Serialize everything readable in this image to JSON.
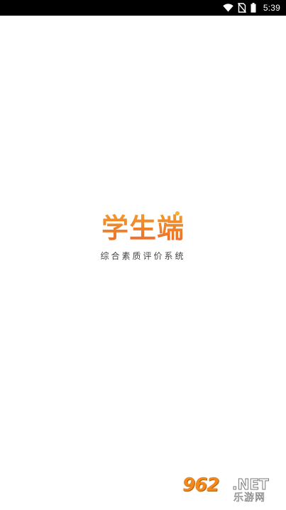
{
  "status_bar": {
    "time": "5:39",
    "icons": [
      "wifi-icon",
      "no-sim-icon",
      "battery-icon"
    ]
  },
  "splash": {
    "logo_title": "学生端",
    "subtitle": "综合素质评价系统"
  },
  "watermark": {
    "logo": "962",
    "net": ".NET",
    "sub": "乐游网"
  },
  "colors": {
    "logo_orange": "#f07a2c",
    "subtitle_text": "#444444",
    "status_bar_bg": "#000000",
    "background": "#ffffff"
  }
}
